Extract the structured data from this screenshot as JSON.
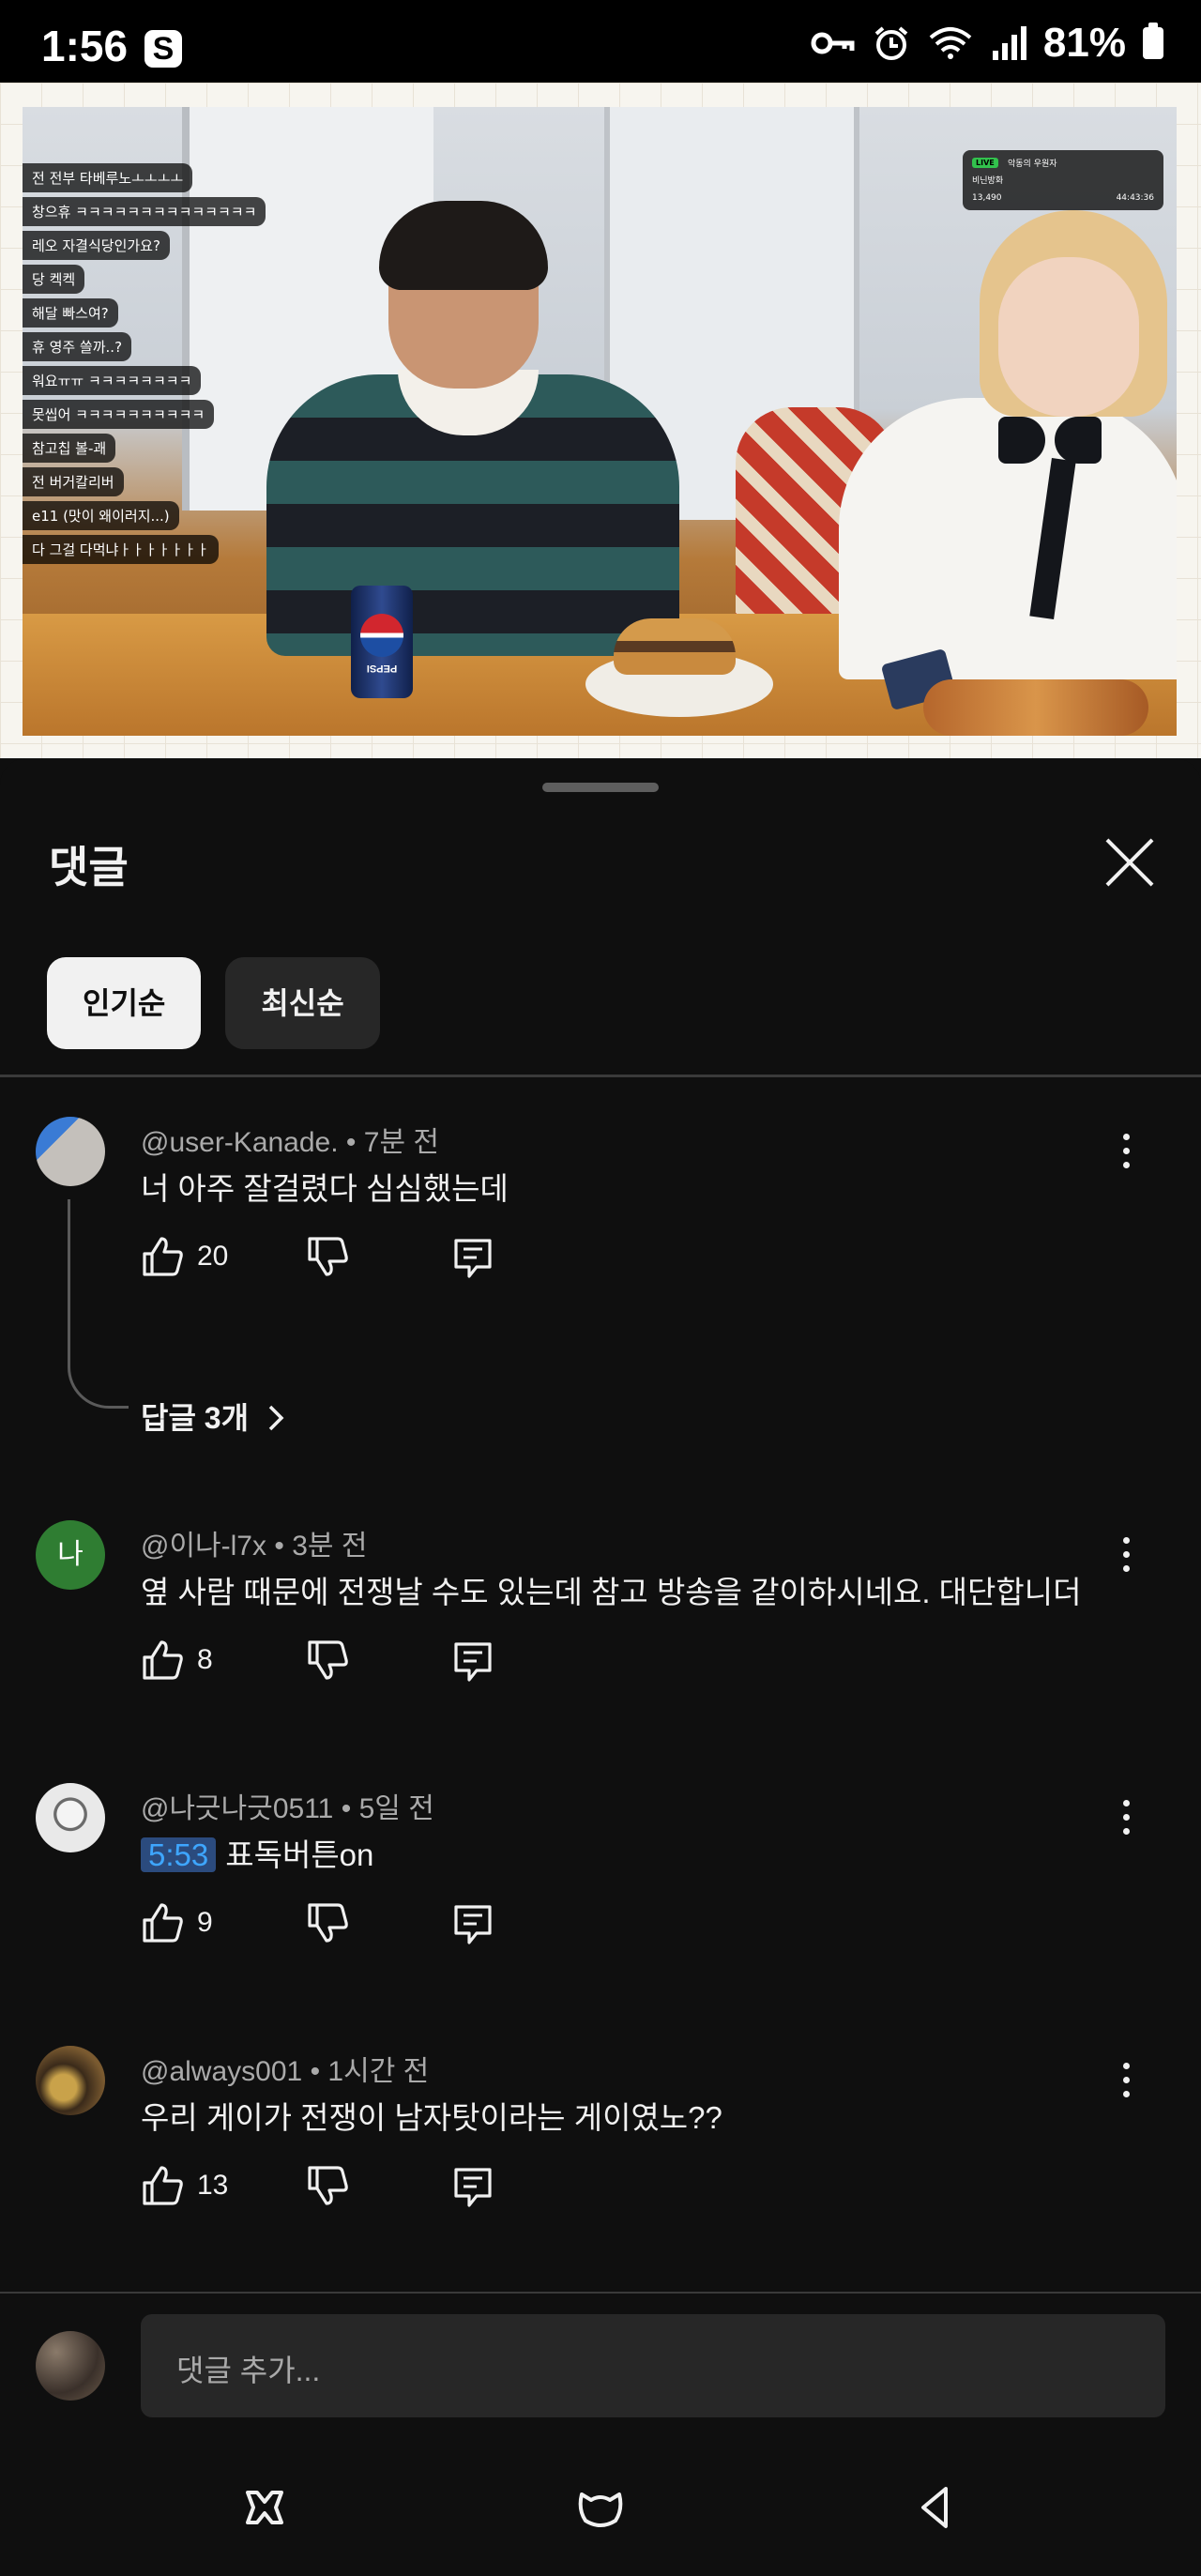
{
  "status_bar": {
    "time": "1:56",
    "s_icon": "S",
    "battery": "81%"
  },
  "video": {
    "chat": [
      "전 전부 타베루노ㅗㅗㅗㅗ",
      "창으휴 ㅋㅋㅋㅋㅋㅋㅋㅋㅋㅋㅋㅋㅋㅋ",
      "레오 자결식당인가요?",
      "당 켁켁",
      "해달 빠스여?",
      "휴 영주 쓸까..?",
      "워요ㅠㅠ ㅋㅋㅋㅋㅋㅋㅋㅋ",
      "못씹어 ㅋㅋㅋㅋㅋㅋㅋㅋㅋㅋ",
      "참고칩 볼-괘",
      "전 버거칼리버",
      "e11 (맛이 왜이러지...)",
      "다 그걸 다먹냐ㅏㅏㅏㅏㅏㅏㅏ"
    ],
    "hud": {
      "badge": "LIVE",
      "name": "악동의 우원자",
      "title": "비닌방화",
      "viewers": "13,490",
      "elapsed": "44:43:36"
    },
    "can_text": "PEPSI"
  },
  "panel": {
    "title": "댓글",
    "chips": [
      "인기순",
      "최신순"
    ]
  },
  "comments": [
    {
      "author": "@user-Kanade.",
      "time": "7분 전",
      "text": "너 아주 잘걸렸다 심심했는데",
      "likes": "20"
    },
    {
      "author": "@이나-l7x",
      "time": "3분 전",
      "text": "옆 사람 때문에 전쟁날 수도 있는데 참고 방송을 같이하시네요. 대단합니더",
      "likes": "8",
      "avatar_letter": "나"
    },
    {
      "author": "@나긋나긋0511",
      "time": "5일 전",
      "timestamp": "5:53",
      "text": "표독버튼on",
      "likes": "9"
    },
    {
      "author": "@always001",
      "time": "1시간 전",
      "text": "우리 게이가 전쟁이 남자탓이라는 게이였노??",
      "likes": "13"
    }
  ],
  "replies_link": "답글 3개",
  "meta_sep": "•",
  "input": {
    "placeholder": "댓글 추가..."
  },
  "colors": {
    "background": "#0f0f0f",
    "chip_active": "#f1f1f1",
    "chip": "#272727",
    "link_blue": "#3ea6ff",
    "avatar_green": "#2f7d32"
  },
  "icons": [
    "key-icon",
    "alarm-icon",
    "wifi-icon",
    "signal-icon",
    "battery-icon",
    "close-icon",
    "more-vert-icon",
    "thumb-up-icon",
    "thumb-down-icon",
    "reply-icon",
    "chevron-right-icon",
    "recents-icon",
    "home-icon",
    "back-icon"
  ]
}
